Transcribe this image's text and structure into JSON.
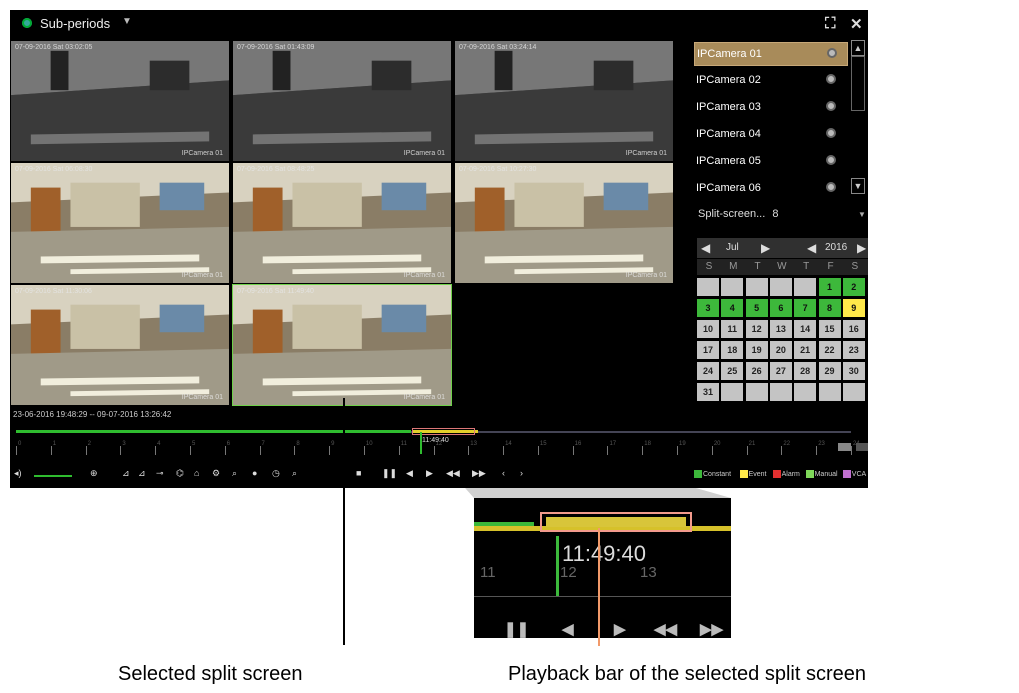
{
  "header": {
    "mode_label": "Sub-periods",
    "fullscreen_icon": "fullscreen-icon",
    "close_icon": "close-icon"
  },
  "tiles": [
    {
      "timestamp": "07-09-2016 Sat 03:02:05",
      "camera": "IPCamera 01",
      "selected": false,
      "scene": "dark"
    },
    {
      "timestamp": "07-09-2016 Sat 01:43:09",
      "camera": "IPCamera 01",
      "selected": false,
      "scene": "dark"
    },
    {
      "timestamp": "07-09-2016 Sat 03:24:14",
      "camera": "IPCamera 01",
      "selected": false,
      "scene": "dark"
    },
    {
      "timestamp": "07-09-2016 Sat 06:08:30",
      "camera": "IPCamera 01",
      "selected": false,
      "scene": "office"
    },
    {
      "timestamp": "07-09-2016 Sat 08:48:25",
      "camera": "IPCamera 01",
      "selected": false,
      "scene": "office"
    },
    {
      "timestamp": "07-09-2016 Sat 10:27:30",
      "camera": "IPCamera 01",
      "selected": false,
      "scene": "office"
    },
    {
      "timestamp": "07-09-2016 Sat 11:30:06",
      "camera": "IPCamera 01",
      "selected": false,
      "scene": "office"
    },
    {
      "timestamp": "07-09-2016 Sat 11:49:40",
      "camera": "IPCamera 01",
      "selected": true,
      "scene": "office"
    }
  ],
  "range_text": "23-06-2016 19:48:29 -- 09-07-2016 13:26:42",
  "camera_list": [
    {
      "label": "IPCamera 01",
      "active": true
    },
    {
      "label": "IPCamera 02",
      "active": false
    },
    {
      "label": "IPCamera 03",
      "active": false
    },
    {
      "label": "IPCamera 04",
      "active": false
    },
    {
      "label": "IPCamera 05",
      "active": false
    },
    {
      "label": "IPCamera 06",
      "active": false
    }
  ],
  "split": {
    "label": "Split-screen...",
    "value": "8"
  },
  "calendar": {
    "month": "Jul",
    "year": "2016",
    "weekdays": [
      "S",
      "M",
      "T",
      "W",
      "T",
      "F",
      "S"
    ],
    "weeks": [
      [
        "",
        "",
        "",
        "",
        "",
        "1",
        "2"
      ],
      [
        "3",
        "4",
        "5",
        "6",
        "7",
        "8",
        "9"
      ],
      [
        "10",
        "11",
        "12",
        "13",
        "14",
        "15",
        "16"
      ],
      [
        "17",
        "18",
        "19",
        "20",
        "21",
        "22",
        "23"
      ],
      [
        "24",
        "25",
        "26",
        "27",
        "28",
        "29",
        "30"
      ],
      [
        "31",
        "",
        "",
        "",
        "",
        "",
        ""
      ]
    ],
    "green_days": [
      "1",
      "2",
      "3",
      "4",
      "5",
      "6",
      "7",
      "8"
    ],
    "yellow_days": [
      "9"
    ]
  },
  "timeline": {
    "current_time": "11:49:40",
    "hour_labels": [
      "0",
      "1",
      "2",
      "3",
      "4",
      "5",
      "6",
      "7",
      "8",
      "9",
      "10",
      "11",
      "12",
      "13",
      "14",
      "15",
      "16",
      "17",
      "18",
      "19",
      "20",
      "21",
      "22",
      "23",
      "24"
    ]
  },
  "legend": [
    {
      "label": "Constant",
      "color": "#3db83b"
    },
    {
      "label": "Event",
      "color": "#ffe94a"
    },
    {
      "label": "Alarm",
      "color": "#e23030"
    },
    {
      "label": "Manual",
      "color": "#7fd85a"
    },
    {
      "label": "VCA",
      "color": "#c070d0"
    }
  ],
  "zoom": {
    "time": "11:49:40",
    "ticks": [
      "11",
      "12",
      "13"
    ]
  },
  "annotations": {
    "selected_split": "Selected split screen",
    "playback_bar": "Playback bar of the selected split screen"
  }
}
